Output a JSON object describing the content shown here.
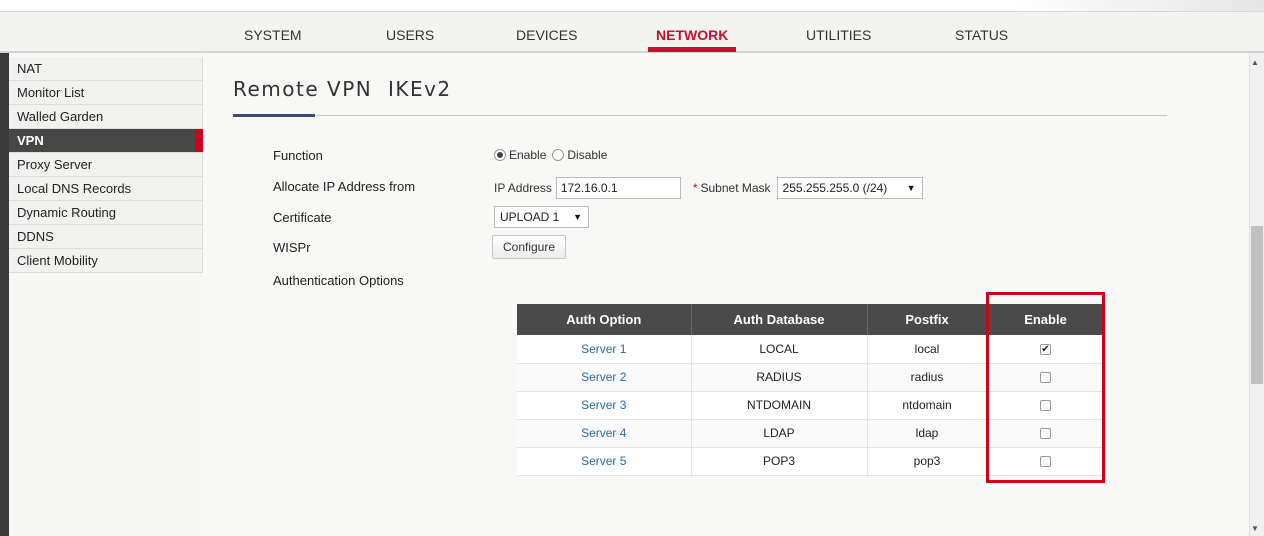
{
  "nav": {
    "tabs": [
      {
        "label": "SYSTEM"
      },
      {
        "label": "USERS"
      },
      {
        "label": "DEVICES"
      },
      {
        "label": "NETWORK"
      },
      {
        "label": "UTILITIES"
      },
      {
        "label": "STATUS"
      }
    ],
    "active_tab": "NETWORK"
  },
  "sidebar": {
    "items": [
      {
        "label": "NAT"
      },
      {
        "label": "Monitor List"
      },
      {
        "label": "Walled Garden"
      },
      {
        "label": "VPN"
      },
      {
        "label": "Proxy Server"
      },
      {
        "label": "Local DNS Records"
      },
      {
        "label": "Dynamic Routing"
      },
      {
        "label": "DDNS"
      },
      {
        "label": "Client Mobility"
      }
    ],
    "active_item": "VPN"
  },
  "page": {
    "title": "Remote VPN  IKEv2"
  },
  "form": {
    "function_label": "Function",
    "function_options": {
      "enable": "Enable",
      "disable": "Disable",
      "selected": "Enable"
    },
    "allocate_label": "Allocate IP Address from",
    "ip_address_label": "IP Address",
    "ip_address_value": "172.16.0.1",
    "required_marker": "*",
    "subnet_mask_label": "Subnet Mask",
    "subnet_mask_value": "255.255.255.0 (/24)",
    "certificate_label": "Certificate",
    "certificate_value": "UPLOAD 1",
    "wispr_label": "WISPr",
    "configure_label": "Configure",
    "auth_options_label": "Authentication Options"
  },
  "auth_table": {
    "headers": [
      "Auth Option",
      "Auth Database",
      "Postfix",
      "Enable"
    ],
    "rows": [
      {
        "option": "Server 1",
        "database": "LOCAL",
        "postfix": "local",
        "enabled": "✔"
      },
      {
        "option": "Server 2",
        "database": "RADIUS",
        "postfix": "radius",
        "enabled": ""
      },
      {
        "option": "Server 3",
        "database": "NTDOMAIN",
        "postfix": "ntdomain",
        "enabled": ""
      },
      {
        "option": "Server 4",
        "database": "LDAP",
        "postfix": "ldap",
        "enabled": ""
      },
      {
        "option": "Server 5",
        "database": "POP3",
        "postfix": "pop3",
        "enabled": ""
      }
    ]
  },
  "icons": {
    "dropdown_arrow": "▼",
    "scroll_up": "▲",
    "scroll_down": "▼"
  },
  "colors": {
    "accent_red": "#c8102e",
    "header_dark": "#4a4a4a",
    "link_blue": "#2a6aa8",
    "title_accent": "#3d4d7a"
  }
}
